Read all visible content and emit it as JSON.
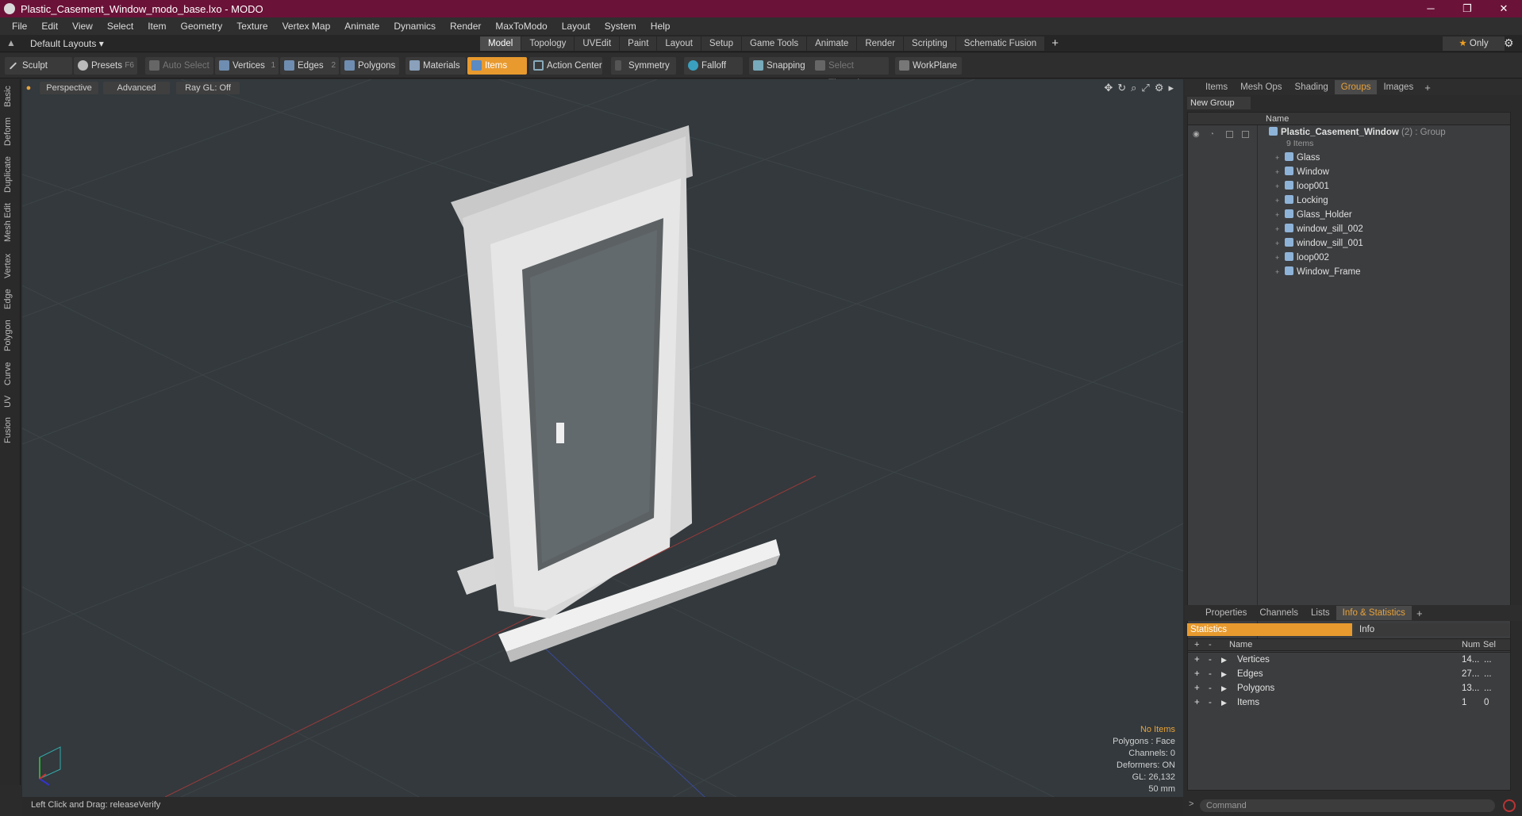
{
  "window": {
    "title": "Plastic_Casement_Window_modo_base.lxo - MODO",
    "minimize": "─",
    "maximize": "❐",
    "close": "✕"
  },
  "menu": [
    "File",
    "Edit",
    "View",
    "Select",
    "Item",
    "Geometry",
    "Texture",
    "Vertex Map",
    "Animate",
    "Dynamics",
    "Render",
    "MaxToModo",
    "Layout",
    "System",
    "Help"
  ],
  "layoutbar": {
    "layouts": "Default Layouts ▾",
    "tabs": [
      "Model",
      "Topology",
      "UVEdit",
      "Paint",
      "Layout",
      "Setup",
      "Game Tools",
      "Animate",
      "Render",
      "Scripting",
      "Schematic Fusion"
    ],
    "active_tab": "Model",
    "add": "+",
    "only": "Only"
  },
  "toolbar": {
    "sculpt": "Sculpt",
    "presets": "Presets",
    "presets_key": "F6",
    "auto_select": "Auto Select",
    "vertices": "Vertices",
    "vertices_key": "1",
    "edges": "Edges",
    "edges_key": "2",
    "polygons": "Polygons",
    "materials": "Materials",
    "items": "Items",
    "action_center": "Action Center",
    "symmetry": "Symmetry",
    "falloff": "Falloff",
    "snapping": "Snapping",
    "select_through": "Select Through",
    "workplane": "WorkPlane"
  },
  "left_tabs": [
    "Basic",
    "Deform",
    "Duplicate",
    "Mesh Edit",
    "Vertex",
    "Edge",
    "Polygon",
    "Curve",
    "UV",
    "Fusion"
  ],
  "viewport": {
    "view": "Perspective",
    "advanced": "Advanced",
    "raygl": "Ray GL: Off"
  },
  "hud": {
    "no_items": "No Items",
    "polygons": "Polygons : Face",
    "channels": "Channels: 0",
    "deformers": "Deformers: ON",
    "gl": "GL: 26,132",
    "scale": "50 mm"
  },
  "status": "Left Click and Drag:  releaseVerify",
  "panel_top": {
    "tabs": [
      "Items",
      "Mesh Ops",
      "Shading",
      "Groups",
      "Images"
    ],
    "active": "Groups",
    "new_group": "New Group",
    "col_name": "Name",
    "group": {
      "name": "Plastic_Casement_Window",
      "count": "(2)",
      "type": ": Group",
      "subtitle": "9 Items"
    },
    "items": [
      "Glass",
      "Window",
      "loop001",
      "Locking",
      "Glass_Holder",
      "window_sill_002",
      "window_sill_001",
      "loop002",
      "Window_Frame"
    ]
  },
  "panel_bottom": {
    "tabs": [
      "Properties",
      "Channels",
      "Lists",
      "Info & Statistics"
    ],
    "active": "Info & Statistics",
    "statistics": "Statistics",
    "info": "Info",
    "cols": {
      "name": "Name",
      "num": "Num",
      "sel": "Sel"
    },
    "rows": [
      {
        "name": "Vertices",
        "num": "14...",
        "sel": "..."
      },
      {
        "name": "Edges",
        "num": "27...",
        "sel": "..."
      },
      {
        "name": "Polygons",
        "num": "13...",
        "sel": "..."
      },
      {
        "name": "Items",
        "num": "1",
        "sel": "0"
      }
    ]
  },
  "command": {
    "placeholder": "Command",
    "prompt": ">"
  }
}
